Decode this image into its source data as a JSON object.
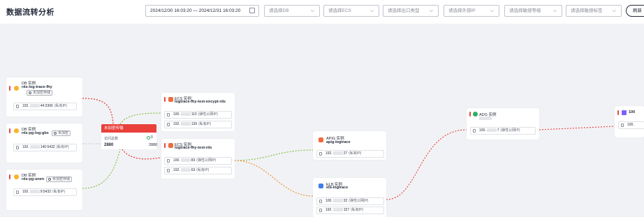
{
  "page": {
    "title": "数据流转分析"
  },
  "filters": {
    "date_range": "2024/12/30 16:03:20 — 2024/12/31 16:03:20",
    "db": "请选择DB",
    "ecs": "请选择ECS",
    "exit_type": "请选择出口类型",
    "external_ip": "请选择外部IP",
    "sensitive_level": "请选择敏感等级",
    "sensitive_tag": "请选择敏感标签",
    "refresh_label": "刷新"
  },
  "nodes": {
    "db1": {
      "type": "DB 实例",
      "name": "rds-log-trace-fhy",
      "badge": "未加密存储",
      "ip": {
        "prefix": "192.",
        "suffix": "44:3306",
        "kind": "(私有IP)"
      }
    },
    "db2": {
      "type": "DB 实例",
      "name": "rds-pg-log-gbx",
      "badge": "未加密",
      "ip": {
        "prefix": "192.",
        "suffix": "140:5432",
        "kind": "(私有IP)"
      }
    },
    "db3": {
      "type": "DB 实例",
      "name": "rds-pg-unen",
      "badge": "未加密存储",
      "ip": {
        "prefix": "192.",
        "suffix": "9:5432",
        "kind": "(私有IP)"
      }
    },
    "ecs1": {
      "type": "ECS 实例",
      "name": "logtrace-fhy-test-encypt-rds",
      "ips": [
        {
          "prefix": "100.",
          "suffix": "110",
          "kind": "(弹性公网IP)"
        },
        {
          "prefix": "192.",
          "suffix": "139",
          "kind": "(私有IP)"
        }
      ]
    },
    "ecs2": {
      "type": "ECS 实例",
      "name": "logtrace-fhy-test-rds",
      "ips": [
        {
          "prefix": "100.",
          "suffix": "83",
          "kind": "(弹性公网IP)"
        },
        {
          "prefix": "192.",
          "suffix": "63",
          "kind": "(私有IP)"
        }
      ]
    },
    "apig": {
      "type": "APIG 实例",
      "name": "apig-logtrace",
      "ip": {
        "prefix": "192.",
        "suffix": "27",
        "kind": "(私有IP)"
      }
    },
    "elb": {
      "type": "ELB 实例",
      "name": "elb-logtrace",
      "ips": [
        {
          "prefix": "100.",
          "suffix": "32",
          "kind": "(弹性公网IP)"
        },
        {
          "prefix": "192.",
          "suffix": "157",
          "kind": "(私有IP)"
        }
      ]
    },
    "adg": {
      "type": "ADG 实例",
      "ip": {
        "prefix": "100.",
        "suffix": "7",
        "kind": "(弹性公网IP)"
      }
    },
    "ext": {
      "type": "100",
      "ip": {
        "prefix": "100."
      }
    }
  },
  "sensitive": {
    "title": "未加密传输",
    "label": "访问总数",
    "total": "2880",
    "right_top": "0",
    "right_bottom": "2880"
  },
  "edge_colors": {
    "red": "#e9403b",
    "green": "#7cbd3a",
    "orange": "#f08a24",
    "gray": "#c2c6cf"
  }
}
